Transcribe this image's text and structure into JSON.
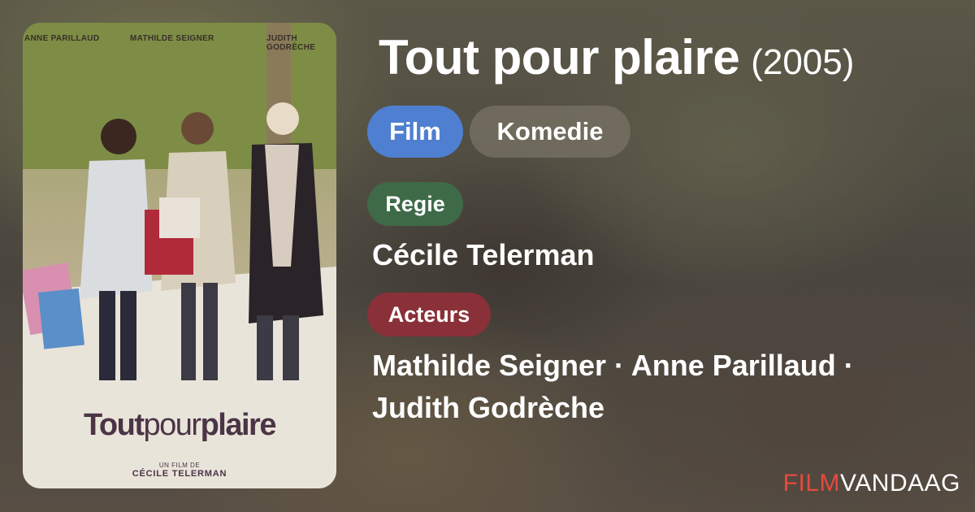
{
  "poster": {
    "credit_1": "ANNE PARILLAUD",
    "credit_2": "MATHILDE SEIGNER",
    "credit_3": "JUDITH GODRÈCHE",
    "title_part_1": "Tout",
    "title_part_2": "pour",
    "title_part_3": "plaire",
    "director_prefix": "UN FILM DE",
    "director_name": "CÉCILE TELERMAN"
  },
  "movie": {
    "title": "Tout pour plaire",
    "year": "(2005)"
  },
  "tags": {
    "type": "Film",
    "genre": "Komedie"
  },
  "director_section": {
    "label": "Regie",
    "name": "Cécile Telerman"
  },
  "cast_section": {
    "label": "Acteurs",
    "names": "Mathilde Seigner · Anne Parillaud · Judith Godrèche"
  },
  "brand": {
    "part_1": "FILM",
    "part_2": "VANDAAG"
  },
  "colors": {
    "film_pill": "#4f7fd0",
    "regie_pill": "#3e6a48",
    "acteurs_pill": "#8a3038",
    "brand_accent": "#e64a3e"
  }
}
